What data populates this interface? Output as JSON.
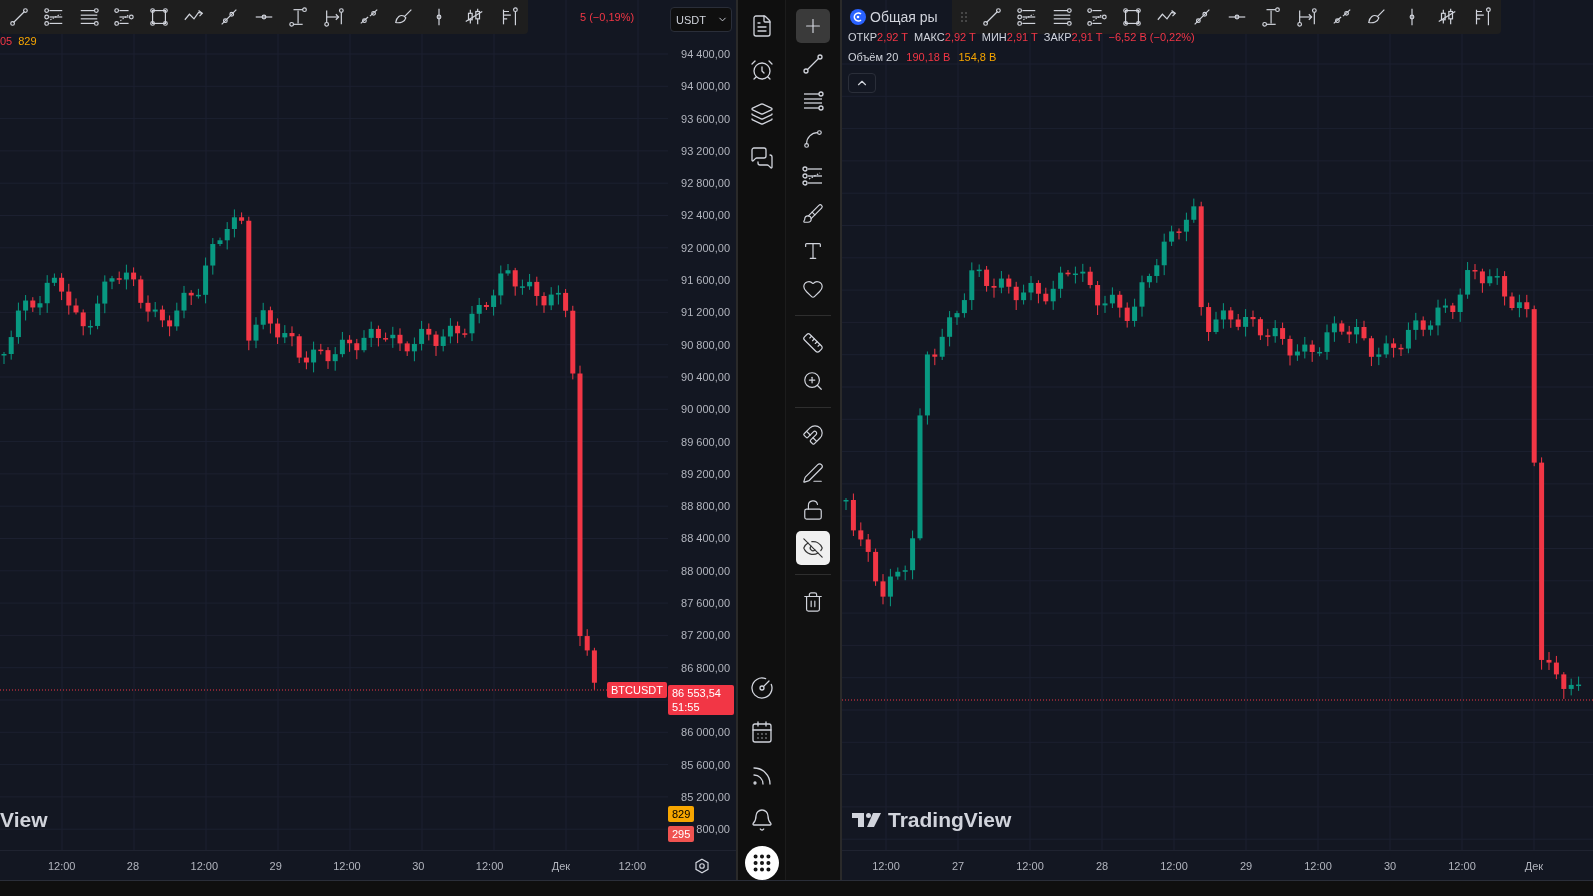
{
  "left_chart": {
    "legend": [
      {
        "text": "05",
        "kind": "price"
      },
      {
        "text": "829",
        "kind": "volume"
      }
    ],
    "change": "5 (−0,19%)",
    "currency": "USDT",
    "price_axis": {
      "upper": [
        "94 400,00",
        "94 000,00",
        "93 600,00",
        "93 200,00",
        "92 800,00",
        "92 400,00",
        "92 000,00",
        "91 600,00",
        "91 200,00",
        "90 800,00",
        "90 400,00",
        "90 000,00",
        "89 600,00",
        "89 200,00",
        "88 800,00",
        "88 400,00",
        "88 000,00",
        "87 600,00",
        "87 200,00",
        "86 800,00"
      ],
      "lower": [
        "86 000,00",
        "85 600,00",
        "85 200,00",
        "800,00"
      ]
    },
    "last_price": {
      "symbol": "BTCUSDT",
      "price": "86 553,54",
      "countdown": "51:55"
    },
    "volume_badges": [
      {
        "text": "829",
        "color": "#f7a600"
      },
      {
        "text": "295",
        "color": "#f05350"
      }
    ],
    "logo_text": "View",
    "time_axis": [
      "12:00",
      "28",
      "12:00",
      "29",
      "12:00",
      "30",
      "12:00",
      "Дек",
      "12:00"
    ]
  },
  "toolbar": {
    "left": [
      {
        "kind": "watchlist"
      },
      {
        "kind": "alerts"
      },
      {
        "kind": "layers"
      },
      {
        "kind": "chats"
      },
      {
        "kind": "spacer"
      },
      {
        "kind": "gauge"
      },
      {
        "kind": "calendar"
      },
      {
        "kind": "feed"
      },
      {
        "kind": "bell"
      },
      {
        "kind": "apps"
      }
    ],
    "tool_groups": [
      [
        {
          "kind": "crosshair",
          "selected": true
        },
        {
          "kind": "trend",
          "selected": false
        },
        {
          "kind": "hlines",
          "selected": false
        },
        {
          "kind": "pattern",
          "selected": false
        },
        {
          "kind": "fib",
          "selected": false
        },
        {
          "kind": "brush",
          "selected": false
        },
        {
          "kind": "text",
          "selected": false
        },
        {
          "kind": "heart",
          "selected": false
        }
      ],
      [
        {
          "kind": "ruler",
          "selected": false
        },
        {
          "kind": "zoom",
          "selected": false
        }
      ],
      [
        {
          "kind": "magnet",
          "selected": false
        },
        {
          "kind": "pencil",
          "selected": false
        },
        {
          "kind": "lock",
          "selected": false
        },
        {
          "kind": "hide",
          "selected": true
        }
      ],
      [
        {
          "kind": "trash",
          "selected": false
        }
      ]
    ]
  },
  "right_chart": {
    "symbol": "Общая ры",
    "ohlc": [
      {
        "label": "ОТКР",
        "value": "2,92 T"
      },
      {
        "label": "МАКС",
        "value": "2,92 T"
      },
      {
        "label": "МИН",
        "value": "2,91 T"
      },
      {
        "label": "ЗАКР",
        "value": "2,91 T"
      }
    ],
    "change": "−6,52 B (−0,22%)",
    "volume": {
      "label": "Объём 20",
      "values": [
        {
          "text": "190,18 B",
          "color": "#f23645"
        },
        {
          "text": "154,8 B",
          "color": "#f7a600"
        }
      ]
    },
    "logo_text": "TradingView",
    "time_axis": [
      "12:00",
      "27",
      "12:00",
      "28",
      "12:00",
      "29",
      "12:00",
      "30",
      "12:00",
      "Дек"
    ]
  }
}
